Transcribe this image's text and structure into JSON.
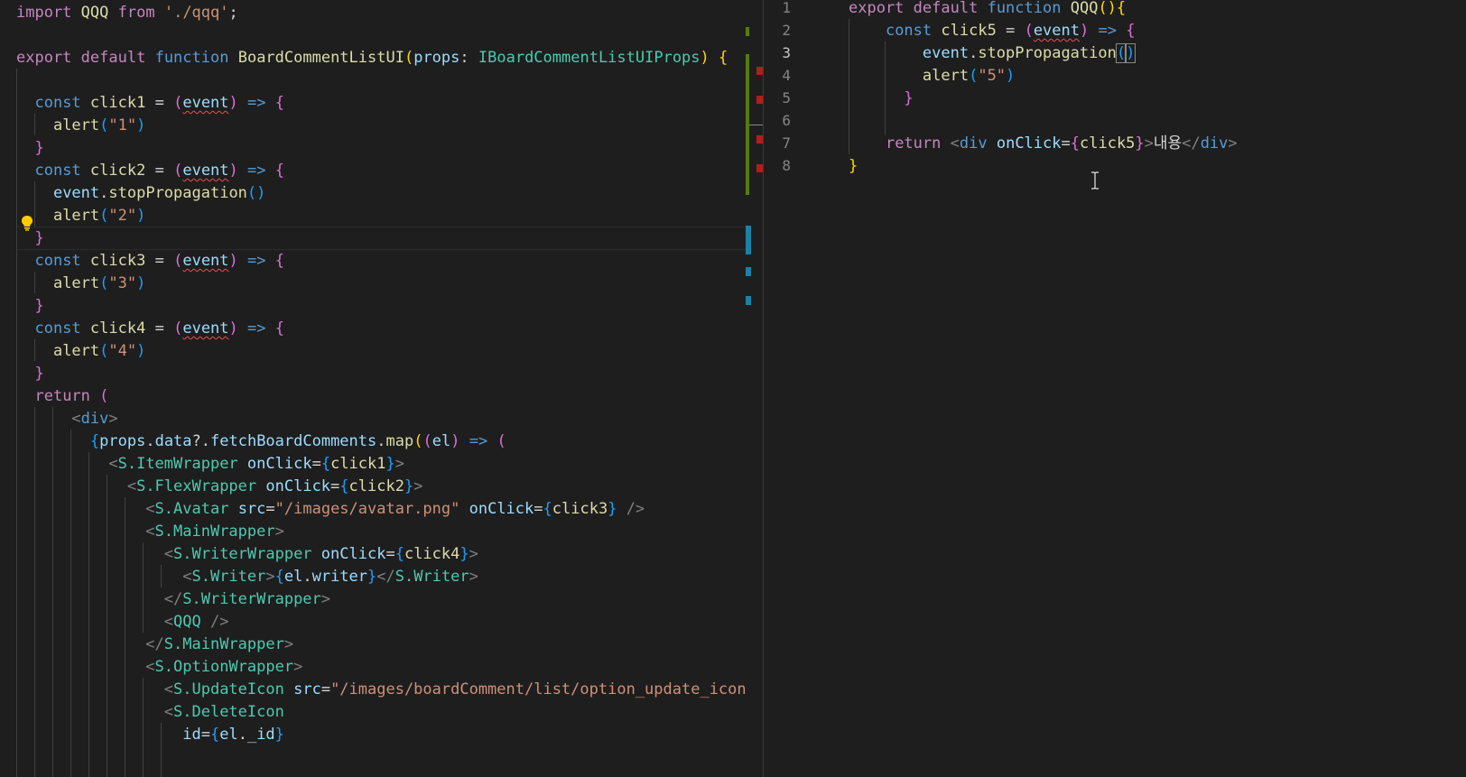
{
  "editor": {
    "colors": {
      "background": "#1e1e1e",
      "keyword": "#569cd6",
      "control": "#c586c0",
      "function": "#dcdcaa",
      "variable": "#9cdcfe",
      "string": "#ce9178",
      "type": "#4ec9b0",
      "error_squiggle": "#f14c4c",
      "added_line": "#587c0c",
      "deleted_line": "#b41c1c",
      "modified_line": "#1b81a8"
    },
    "icons": {
      "lightbulb": "lightbulb-icon",
      "text_cursor": "text-cursor-icon"
    }
  },
  "left_editor": {
    "t": {
      "import": "import",
      "qqq": "QQQ",
      "from": "from",
      "path": "'./qqq'",
      "semi": ";",
      "export": "export",
      "default": "default",
      "function": "function",
      "name": "BoardCommentListUI",
      "props": "props",
      "colon": ":",
      "type": "IBoardCommentListUIProps",
      "const": "const",
      "click1": "click1",
      "click2": "click2",
      "click3": "click3",
      "click4": "click4",
      "eq": "=",
      "event": "event",
      "arrow": "=>",
      "alert": "alert",
      "s1": "\"1\"",
      "s2": "\"2\"",
      "s3": "\"3\"",
      "s4": "\"4\"",
      "stop": "stopPropagation",
      "return": "return",
      "div": "div",
      "data": "data",
      "fetch": "fetchBoardComments",
      "map": "map",
      "el": "el",
      "itemWrapper": "S.ItemWrapper",
      "flexWrapper": "S.FlexWrapper",
      "avatar": "S.Avatar",
      "mainWrapper": "S.MainWrapper",
      "writerWrapper": "S.WriterWrapper",
      "writer": "S.Writer",
      "optionWrapper": "S.OptionWrapper",
      "updateIcon": "S.UpdateIcon",
      "deleteIcon": "S.DeleteIcon",
      "onClick": "onClick",
      "src": "src",
      "id": "id",
      "_id": "_id",
      "avatarSrc": "\"/images/avatar.png\"",
      "updateSrc": "\"/images/boardComment/list/option_update_icon."
    }
  },
  "right_editor": {
    "line_numbers": [
      "1",
      "2",
      "3",
      "4",
      "5",
      "6",
      "7",
      "8"
    ],
    "active_line": "3",
    "t": {
      "export": "export",
      "default": "default",
      "function": "function",
      "name": "QQQ",
      "const": "const",
      "click5": "click5",
      "eq": "=",
      "event": "event",
      "arrow": "=>",
      "stop": "stopPropagation",
      "alert": "alert",
      "s5": "\"5\"",
      "return": "return",
      "div": "div",
      "onClick": "onClick",
      "content": "내용"
    }
  }
}
